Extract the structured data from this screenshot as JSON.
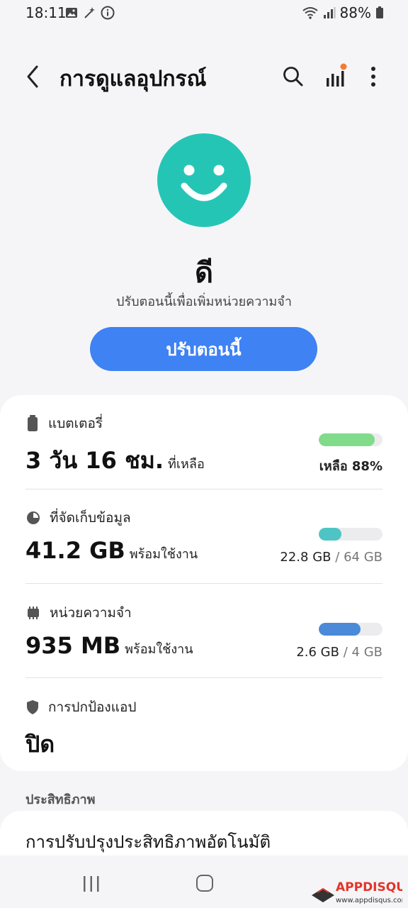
{
  "status_bar": {
    "time": "18:11",
    "battery_percent": "88%"
  },
  "app_bar": {
    "title": "การดูแลอุปกรณ์"
  },
  "device_status": {
    "word": "ดี",
    "subtitle": "ปรับตอนนี้เพื่อเพิ่มหน่วยความจำ",
    "button_label": "ปรับตอนนี้"
  },
  "battery": {
    "label": "แบตเตอรี่",
    "value": "3 วัน 16 ชม.",
    "value_suffix": "ที่เหลือ",
    "right_text": "เหลือ 88%",
    "level": 0.88,
    "color": "#80dc8a"
  },
  "storage": {
    "label": "ที่จัดเก็บข้อมูล",
    "value": "41.2 GB",
    "value_suffix": "พร้อมใช้งาน",
    "used": "22.8 GB",
    "sep": "/",
    "total": "64 GB",
    "level": 0.356,
    "color": "#4fc4c4"
  },
  "memory": {
    "label": "หน่วยความจำ",
    "value": "935 MB",
    "value_suffix": "พร้อมใช้งาน",
    "used": "2.6 GB",
    "sep": "/",
    "total": "4 GB",
    "level": 0.65,
    "color": "#4a8ad8"
  },
  "app_protection": {
    "label": "การปกป้องแอป",
    "value": "ปิด"
  },
  "performance": {
    "section_title": "ประสิทธิภาพ",
    "item_label": "การปรับปรุงประสิทธิภาพอัตโนมัติ"
  },
  "watermark": {
    "brand": "APPDISQUS",
    "url": "www.appdisqus.com"
  }
}
